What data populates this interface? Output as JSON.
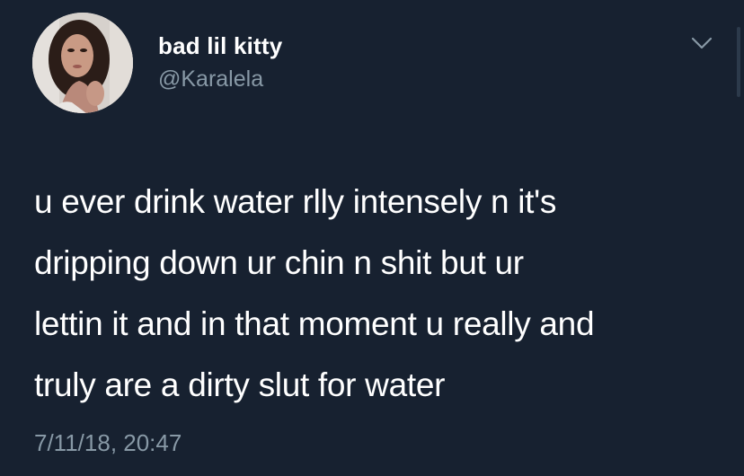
{
  "user": {
    "display_name": "bad lil kitty",
    "handle": "@Karalela"
  },
  "tweet": {
    "lines": [
      "u ever drink water rlly intensely n it's",
      "dripping down ur chin n shit but ur",
      "lettin it and in that moment u really and",
      "truly are a dirty slut for water"
    ],
    "timestamp": "7/11/18, 20:47"
  },
  "icons": {
    "avatar": "profile-photo",
    "menu": "chevron-down-icon"
  },
  "colors": {
    "background": "#172130",
    "text": "#ffffff",
    "secondary_text": "#8899a6"
  }
}
